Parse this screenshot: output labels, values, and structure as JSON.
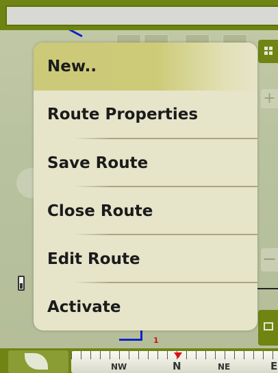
{
  "menu": {
    "items": [
      {
        "label": "New..",
        "selected": true
      },
      {
        "label": "Route Properties",
        "selected": false
      },
      {
        "label": "Save Route",
        "selected": false
      },
      {
        "label": "Close Route",
        "selected": false
      },
      {
        "label": "Edit Route",
        "selected": false
      },
      {
        "label": "Activate",
        "selected": false
      }
    ]
  },
  "compass": {
    "labels": [
      "NW",
      "N",
      "NE",
      "E"
    ],
    "marker_color": "#dd1111"
  },
  "map": {
    "route_label": "1"
  },
  "colors": {
    "bar_green": "#6f8413",
    "menu_bg": "#e6e4c9",
    "selected_highlight": "#ccca78",
    "route_blue": "#0d22c9"
  },
  "icons": [
    "grid-icon",
    "zoom-in-icon",
    "zoom-out-icon",
    "pan-icon",
    "battery-icon",
    "leaf-icon",
    "layers-icon",
    "compass-north-marker-icon"
  ]
}
